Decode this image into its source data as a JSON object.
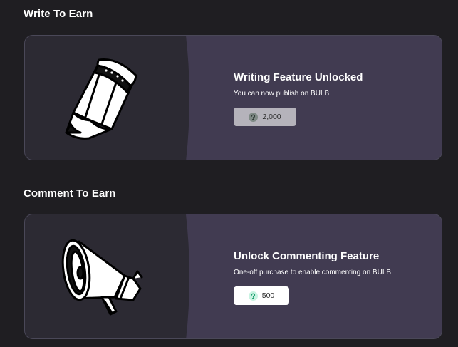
{
  "sections": [
    {
      "title": "Write To Earn",
      "card": {
        "illustration": "pencil-icon",
        "title": "Writing Feature Unlocked",
        "description": "You can now publish on BULB",
        "price": "2,000",
        "price_state": "disabled",
        "token_icon": "bulb-token-icon"
      }
    },
    {
      "title": "Comment To Earn",
      "card": {
        "illustration": "megaphone-icon",
        "title": "Unlock Commenting Feature",
        "description": "One-off purchase to enable commenting on BULB",
        "price": "500",
        "price_state": "active",
        "token_icon": "bulb-token-icon"
      }
    }
  ],
  "colors": {
    "page_background": "#1f1e22",
    "card_left": "#2c2a33",
    "card_right": "#413b51",
    "card_border": "#4a4858",
    "disabled_button": "#b5b3bb",
    "active_button": "#ffffff",
    "token_accent": "#3ecf9a"
  }
}
